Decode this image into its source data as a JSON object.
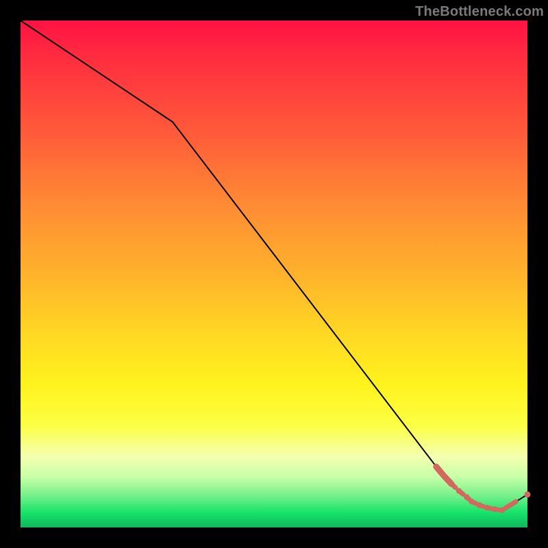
{
  "attribution": "TheBottleneck.com",
  "colors": {
    "highlight": "#d2695e",
    "line": "#000000",
    "background": "#000000"
  },
  "chart_data": {
    "type": "line",
    "title": "",
    "xlabel": "",
    "ylabel": "",
    "xlim": [
      0,
      100
    ],
    "ylim": [
      0,
      100
    ],
    "grid": false,
    "legend": false,
    "series": [
      {
        "name": "main",
        "x": [
          0,
          30,
          82,
          83.5,
          85,
          86.5,
          88,
          89,
          90.5,
          92,
          93.5,
          95,
          100
        ],
        "y": [
          100,
          80,
          12,
          10.2,
          8.6,
          7.2,
          6,
          5.1,
          4.4,
          3.9,
          3.6,
          3.4,
          6.5
        ],
        "highlight_from_index": 2
      }
    ],
    "annotations": []
  }
}
